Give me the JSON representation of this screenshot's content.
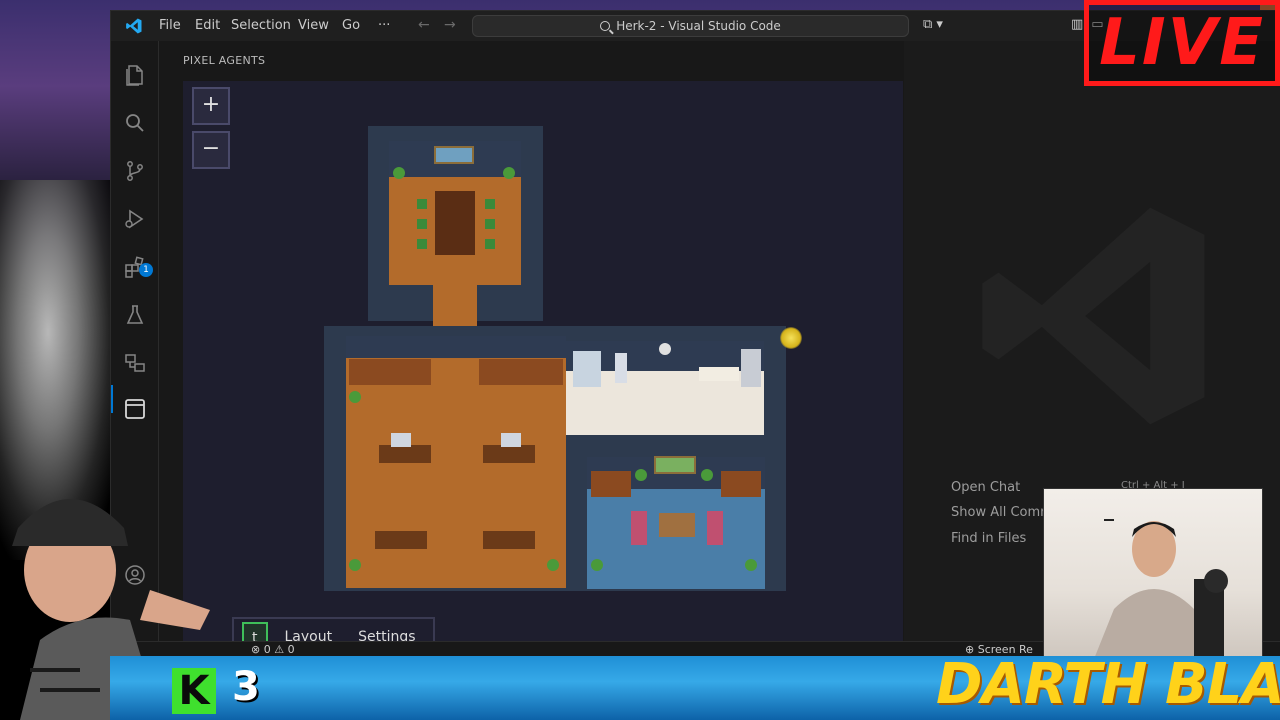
{
  "titlebar": {
    "menu": [
      "File",
      "Edit",
      "Selection",
      "View",
      "Go",
      "···"
    ],
    "command_center": "Herk-2 - Visual Studio Code"
  },
  "panel": {
    "title": "PIXEL AGENTS",
    "zoom_in": "+",
    "zoom_out": "−",
    "buttons": {
      "agent": "t",
      "layout": "Layout",
      "settings": "Settings"
    }
  },
  "editor": {
    "shortcuts": [
      "Open Chat",
      "Show All Comm",
      "Find in Files"
    ],
    "open_chat_keys": "Ctrl + Alt + I"
  },
  "statusbar": {
    "errors": "0",
    "warnings": "0",
    "right_text": "Screen Re"
  },
  "overlay": {
    "live": "LIVE",
    "kick_logo": "K",
    "kick_count": "3",
    "brand": "DARTH BLAZE"
  },
  "colors": {
    "accent": "#0078d4",
    "live_red": "#ff1a1a",
    "kick_green": "#3fe02e",
    "brand_yellow": "#ffd21a"
  },
  "icons": {
    "activity_bar": [
      "explorer-icon",
      "search-icon",
      "source-control-icon",
      "run-debug-icon",
      "extensions-icon",
      "testing-icon",
      "remote-explorer-icon",
      "pixel-agents-icon",
      "account-icon"
    ],
    "extensions_badge": "1"
  }
}
